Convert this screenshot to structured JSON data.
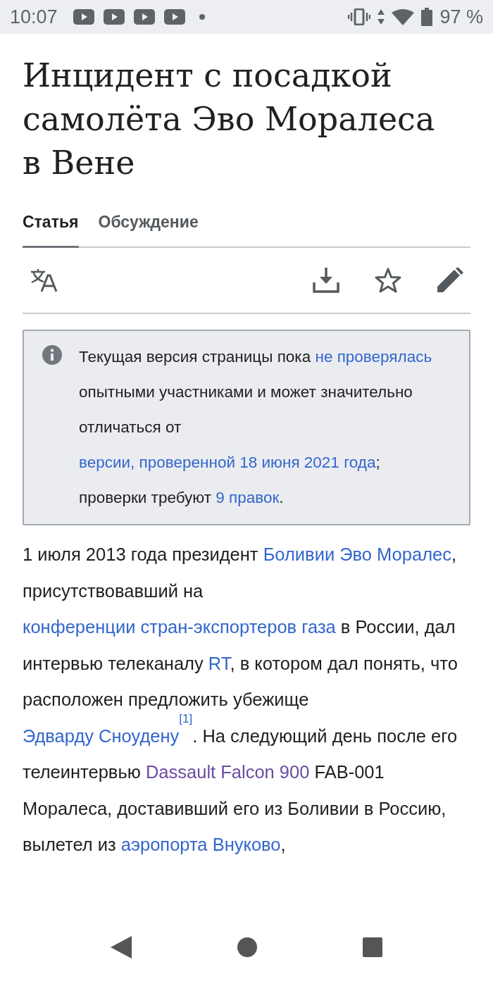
{
  "status_bar": {
    "time": "10:07",
    "battery": "97 %"
  },
  "title": "Инцидент с посадкой самолёта Эво Моралеса в Вене",
  "tabs": [
    {
      "label": "Статья",
      "selected": true
    },
    {
      "label": "Обсуждение",
      "selected": false
    }
  ],
  "notice": [
    {
      "kind": "plain",
      "text": "Текущая версия страницы пока "
    },
    {
      "kind": "link",
      "text": "не проверялась"
    },
    {
      "kind": "plain",
      "text": " опытными участниками и может значительно отличаться от "
    },
    {
      "kind": "link",
      "text": "версии, проверенной 18 июня 2021 года"
    },
    {
      "kind": "plain",
      "text": "; проверки требуют "
    },
    {
      "kind": "link",
      "text": "9 правок"
    },
    {
      "kind": "plain",
      "text": "."
    }
  ],
  "paragraph": [
    {
      "kind": "plain",
      "text": "1 июля 2013 года президент "
    },
    {
      "kind": "link",
      "text": "Боливии Эво Моралес"
    },
    {
      "kind": "plain",
      "text": ", присутствовавший на "
    },
    {
      "kind": "link",
      "text": "конференции стран-экспортеров газа"
    },
    {
      "kind": "plain",
      "text": " в России, дал интервью телеканалу "
    },
    {
      "kind": "link",
      "text": "RT"
    },
    {
      "kind": "plain",
      "text": ", в котором дал понять, что расположен предложить убежище "
    },
    {
      "kind": "link",
      "text": "Эдварду Сноудену"
    },
    {
      "kind": "ref",
      "text": "[1]"
    },
    {
      "kind": "plain",
      "text": ". На следующий день после его телеинтервью "
    },
    {
      "kind": "visited",
      "text": "Dassault Falcon 900"
    },
    {
      "kind": "plain",
      "text": " FAB-001 Моралеса, доставивший его из Боливии в Россию, вылетел из "
    },
    {
      "kind": "link",
      "text": "аэропорта Внуково"
    },
    {
      "kind": "plain",
      "text": ","
    }
  ]
}
